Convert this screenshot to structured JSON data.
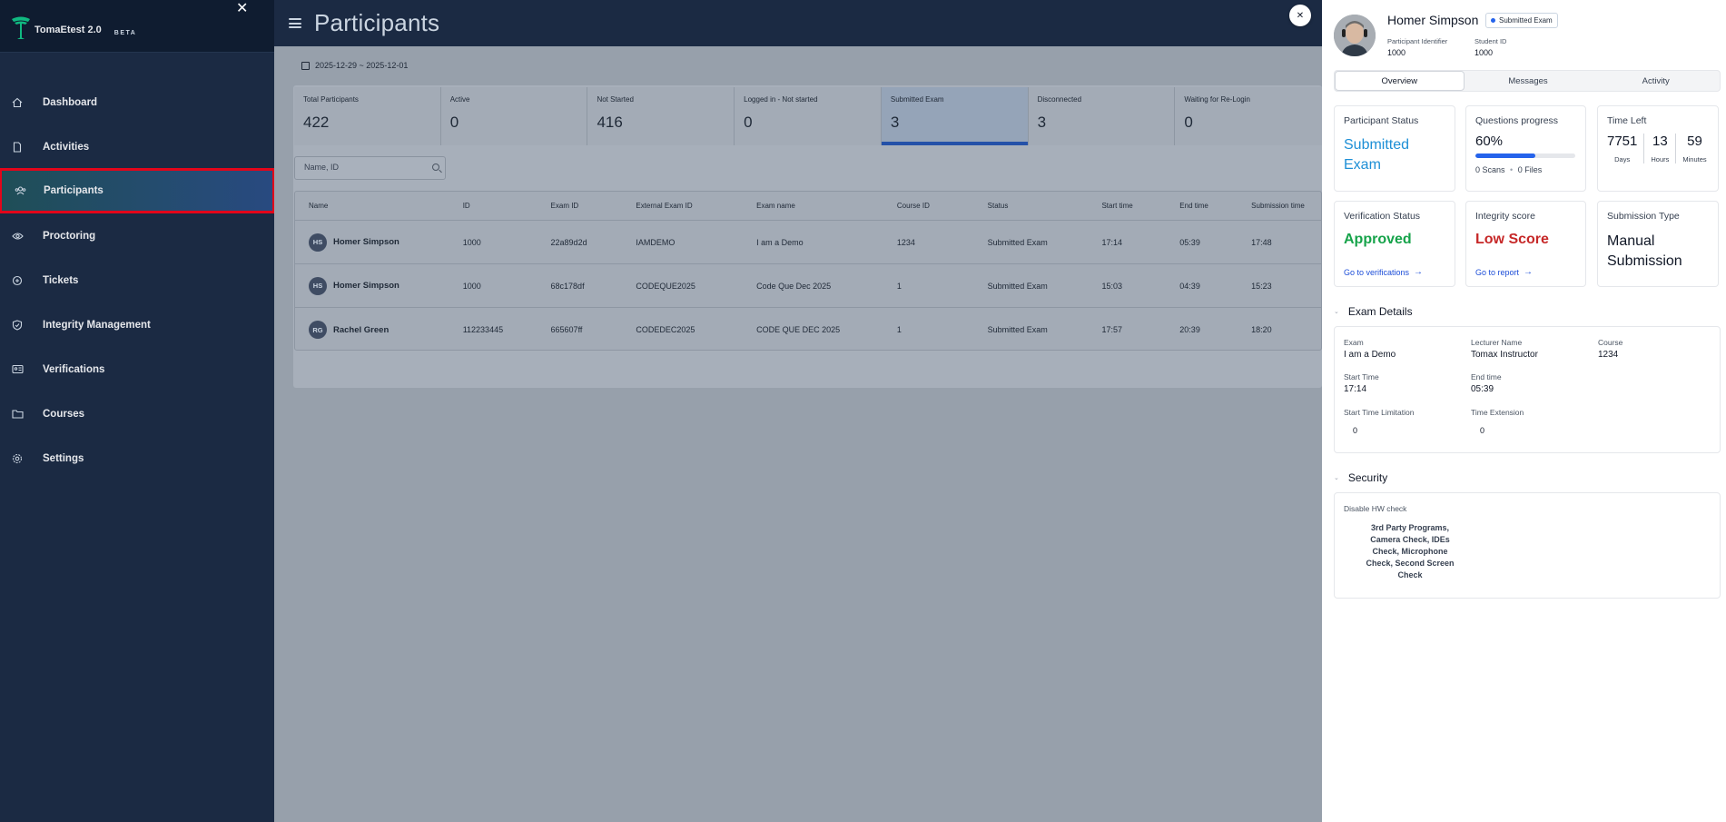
{
  "app": {
    "name": "TomaEtest 2.0",
    "beta": "BETA"
  },
  "sidebar": {
    "items": [
      {
        "label": "Dashboard",
        "icon": "home-icon"
      },
      {
        "label": "Activities",
        "icon": "document-icon"
      },
      {
        "label": "Participants",
        "icon": "users-icon",
        "active": true
      },
      {
        "label": "Proctoring",
        "icon": "eye-icon"
      },
      {
        "label": "Tickets",
        "icon": "ticket-icon"
      },
      {
        "label": "Integrity Management",
        "icon": "shield-icon"
      },
      {
        "label": "Verifications",
        "icon": "id-card-icon"
      },
      {
        "label": "Courses",
        "icon": "folder-icon"
      },
      {
        "label": "Settings",
        "icon": "gear-icon"
      }
    ]
  },
  "header": {
    "title": "Participants"
  },
  "filters": {
    "date_range": "2025-12-29 ~ 2025-12-01",
    "search_placeholder": "Name,  ID"
  },
  "stats": [
    {
      "label": "Total Participants",
      "value": "422"
    },
    {
      "label": "Active",
      "value": "0"
    },
    {
      "label": "Not Started",
      "value": "416"
    },
    {
      "label": "Logged in - Not started",
      "value": "0"
    },
    {
      "label": "Submitted Exam",
      "value": "3",
      "selected": true
    },
    {
      "label": "Disconnected",
      "value": "3"
    },
    {
      "label": "Waiting for Re-Login",
      "value": "0"
    }
  ],
  "table": {
    "columns": [
      "Name",
      "ID",
      "Exam ID",
      "External Exam ID",
      "Exam name",
      "Course ID",
      "Status",
      "Start time",
      "End time",
      "Submission time"
    ],
    "rows": [
      {
        "initials": "HS",
        "name": "Homer Simpson",
        "id": "1000",
        "exam_id": "22a89d2d",
        "ext_id": "IAMDEMO",
        "exam_name": "I am a Demo",
        "course_id": "1234",
        "status": "Submitted Exam",
        "start": "17:14",
        "end": "05:39",
        "submission": "17:48"
      },
      {
        "initials": "HS",
        "name": "Homer Simpson",
        "id": "1000",
        "exam_id": "68c178df",
        "ext_id": "CODEQUE2025",
        "exam_name": "Code Que Dec 2025",
        "course_id": "1",
        "status": "Submitted Exam",
        "start": "15:03",
        "end": "04:39",
        "submission": "15:23"
      },
      {
        "initials": "RG",
        "name": "Rachel Green",
        "id": "112233445",
        "exam_id": "665607ff",
        "ext_id": "CODEDEC2025",
        "exam_name": "CODE QUE DEC 2025",
        "course_id": "1",
        "status": "Submitted Exam",
        "start": "17:57",
        "end": "20:39",
        "submission": "18:20"
      }
    ]
  },
  "drawer": {
    "name": "Homer Simpson",
    "badge": "Submitted Exam",
    "participant_identifier_label": "Participant Identifier",
    "participant_identifier": "1000",
    "student_id_label": "Student ID",
    "student_id": "1000",
    "tabs": [
      "Overview",
      "Messages",
      "Activity"
    ],
    "participant_status": {
      "title": "Participant Status",
      "value": "Submitted Exam"
    },
    "questions_progress": {
      "title": "Questions progress",
      "percent": "60%",
      "fraction": 0.6,
      "scans": "0 Scans",
      "files": "0 Files"
    },
    "time_left": {
      "title": "Time Left",
      "days": "7751",
      "days_label": "Days",
      "hours": "13",
      "hours_label": "Hours",
      "minutes": "59",
      "minutes_label": "Minutes"
    },
    "verification_status": {
      "title": "Verification Status",
      "value": "Approved",
      "link": "Go to verifications"
    },
    "integrity_score": {
      "title": "Integrity score",
      "value": "Low Score",
      "link": "Go to report"
    },
    "submission_type": {
      "title": "Submission Type",
      "value": "Manual Submission"
    },
    "exam_details": {
      "heading": "Exam Details",
      "exam_label": "Exam",
      "exam": "I am a Demo",
      "lecturer_label": "Lecturer Name",
      "lecturer": "Tomax Instructor",
      "course_label": "Course",
      "course": "1234",
      "start_label": "Start Time",
      "start": "17:14",
      "end_label": "End time",
      "end": "05:39",
      "stl_label": "Start Time Limitation",
      "stl": "0",
      "ext_label": "Time Extension",
      "ext": "0"
    },
    "security": {
      "heading": "Security",
      "hw_label": "Disable HW check",
      "hw_value": "3rd Party Programs, Camera Check, IDEs Check, Microphone Check, Second Screen Check"
    }
  },
  "colors": {
    "sidebar": "#1b2a43",
    "accent": "#2563eb",
    "approved": "#16a34a",
    "low": "#c62828",
    "highlight": "#e3051a"
  }
}
